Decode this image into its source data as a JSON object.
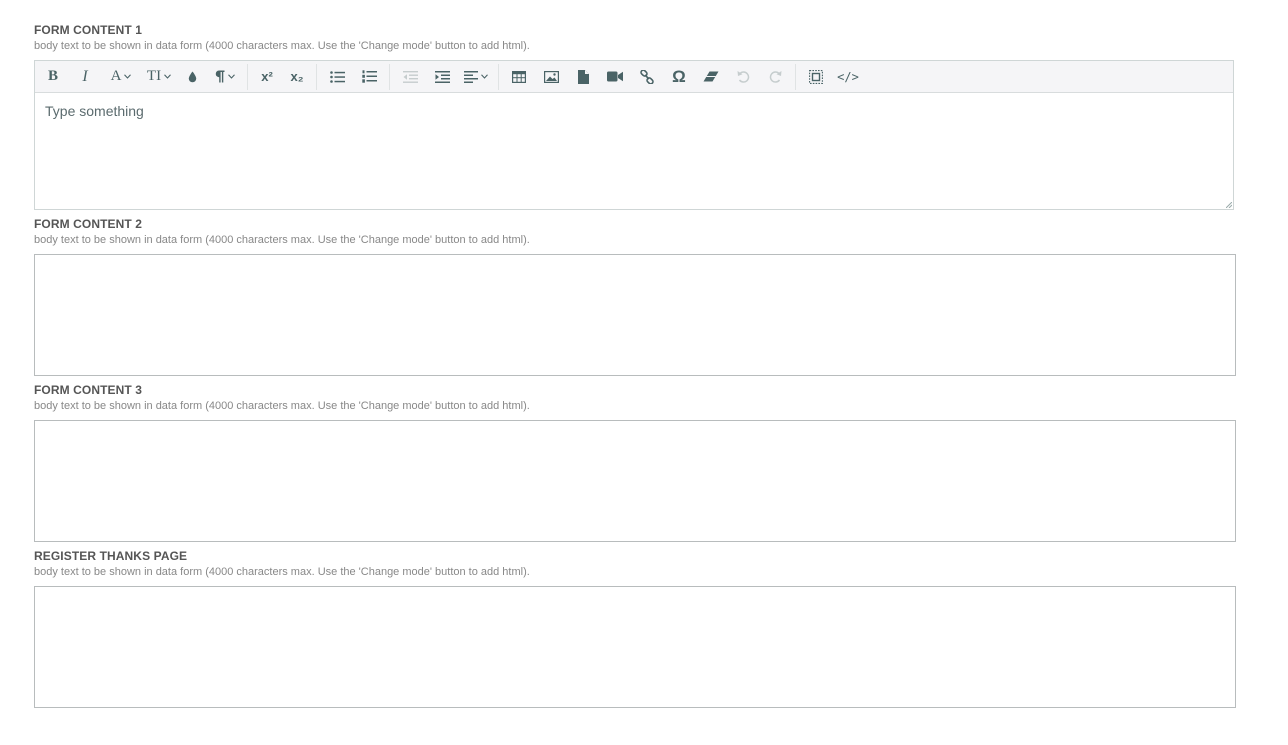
{
  "fields": [
    {
      "label": "FORM CONTENT 1",
      "help": "body text to be shown in data form (4000 characters max. Use the 'Change mode' button to add html).",
      "placeholder": "Type something"
    },
    {
      "label": "FORM CONTENT 2",
      "help": "body text to be shown in data form (4000 characters max. Use the 'Change mode' button to add html).",
      "value": ""
    },
    {
      "label": "FORM CONTENT 3",
      "help": "body text to be shown in data form (4000 characters max. Use the 'Change mode' button to add html).",
      "value": ""
    },
    {
      "label": "REGISTER THANKS PAGE",
      "help": "body text to be shown in data form (4000 characters max. Use the 'Change mode' button to add html).",
      "value": ""
    }
  ],
  "toolbar": {
    "bold": "B",
    "italic": "I",
    "font_family": "A",
    "font_size": "TI",
    "superscript": "x²",
    "subscript": "x₂",
    "special_chars": "Ω",
    "code_view": "</>"
  },
  "colors": {
    "icon": "#4a6366",
    "icon_disabled": "#c6cdce",
    "toolbar_bg": "#f5f5f7",
    "label": "#555555",
    "help": "#888888"
  }
}
